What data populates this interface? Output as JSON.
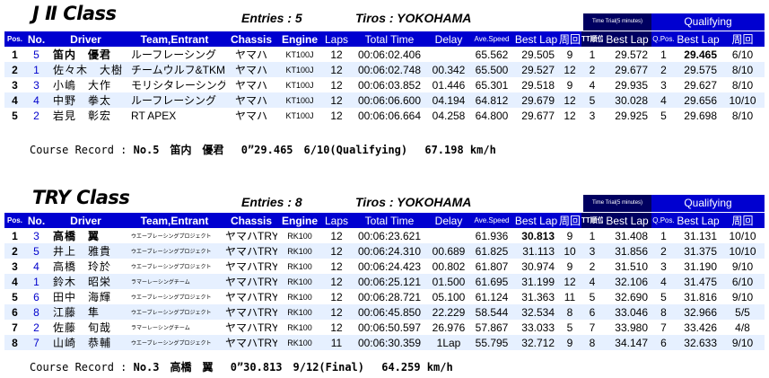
{
  "columns": [
    "Pos.",
    "No.",
    "Driver",
    "Team,Entrant",
    "Chassis",
    "Engine",
    "Laps",
    "Total Time",
    "Delay",
    "Ave.Speed",
    "Best Lap",
    "周回",
    "TT順位",
    "Best Lap",
    "Q.Pos.",
    "Best Lap",
    "周回"
  ],
  "tt_label": "Time Trial(5 minutes)",
  "q_label": "Qualifying",
  "sections": [
    {
      "title": "J Ⅱ Class",
      "entries": "Entries : 5",
      "tiros": "Tiros : YOKOHAMA",
      "rows": [
        {
          "pos": "1",
          "no": "5",
          "driver": "笛内　優君",
          "team": "ルーフレーシング",
          "chassis": "ヤマハ",
          "engine": "KT100J",
          "laps": "12",
          "total": "00:06:02.406",
          "delay": "",
          "ave": "65.562",
          "best": "29.505",
          "lap": "9",
          "ttpos": "1",
          "ttbest": "29.572",
          "qpos": "1",
          "qbest": "29.465",
          "qlap": "6/10"
        },
        {
          "pos": "2",
          "no": "1",
          "driver": "佐々木　大樹",
          "team": "チームウルフ&TKM",
          "chassis": "ヤマハ",
          "engine": "KT100J",
          "laps": "12",
          "total": "00:06:02.748",
          "delay": "00.342",
          "ave": "65.500",
          "best": "29.527",
          "lap": "12",
          "ttpos": "2",
          "ttbest": "29.677",
          "qpos": "2",
          "qbest": "29.575",
          "qlap": "8/10"
        },
        {
          "pos": "3",
          "no": "3",
          "driver": "小嶋　大作",
          "team": "モリシタレーシング",
          "chassis": "ヤマハ",
          "engine": "KT100J",
          "laps": "12",
          "total": "00:06:03.852",
          "delay": "01.446",
          "ave": "65.301",
          "best": "29.518",
          "lap": "9",
          "ttpos": "4",
          "ttbest": "29.935",
          "qpos": "3",
          "qbest": "29.627",
          "qlap": "8/10"
        },
        {
          "pos": "4",
          "no": "4",
          "driver": "中野　拳太",
          "team": "ルーフレーシング",
          "chassis": "ヤマハ",
          "engine": "KT100J",
          "laps": "12",
          "total": "00:06:06.600",
          "delay": "04.194",
          "ave": "64.812",
          "best": "29.679",
          "lap": "12",
          "ttpos": "5",
          "ttbest": "30.028",
          "qpos": "4",
          "qbest": "29.656",
          "qlap": "10/10"
        },
        {
          "pos": "5",
          "no": "2",
          "driver": "岩見　彰宏",
          "team": "RT APEX",
          "chassis": "ヤマハ",
          "engine": "KT100J",
          "laps": "12",
          "total": "00:06:06.664",
          "delay": "04.258",
          "ave": "64.800",
          "best": "29.677",
          "lap": "12",
          "ttpos": "3",
          "ttbest": "29.925",
          "qpos": "5",
          "qbest": "29.698",
          "qlap": "8/10"
        }
      ],
      "record_label": "Course Record :",
      "record_value": "No.5　笛内　優君　 0”29.465　6/10(Qualifying)　 67.198 km/h"
    },
    {
      "title": "TRY Class",
      "entries": "Entries : 8",
      "tiros": "Tiros : YOKOHAMA",
      "rows": [
        {
          "pos": "1",
          "no": "3",
          "driver": "高橋　翼",
          "team": "ウエーブレーシングプロジェクト",
          "chassis": "ヤマハTRY",
          "engine": "RK100",
          "laps": "12",
          "total": "00:06:23.621",
          "delay": "",
          "ave": "61.936",
          "best": "30.813",
          "lap": "9",
          "ttpos": "1",
          "ttbest": "31.408",
          "qpos": "1",
          "qbest": "31.131",
          "qlap": "10/10"
        },
        {
          "pos": "2",
          "no": "5",
          "driver": "井上　雅貴",
          "team": "ウエーブレーシングプロジェクト",
          "chassis": "ヤマハTRY",
          "engine": "RK100",
          "laps": "12",
          "total": "00:06:24.310",
          "delay": "00.689",
          "ave": "61.825",
          "best": "31.113",
          "lap": "10",
          "ttpos": "3",
          "ttbest": "31.856",
          "qpos": "2",
          "qbest": "31.375",
          "qlap": "10/10"
        },
        {
          "pos": "3",
          "no": "4",
          "driver": "高橋　玲於",
          "team": "ウエーブレーシングプロジェクト",
          "chassis": "ヤマハTRY",
          "engine": "RK100",
          "laps": "12",
          "total": "00:06:24.423",
          "delay": "00.802",
          "ave": "61.807",
          "best": "30.974",
          "lap": "9",
          "ttpos": "2",
          "ttbest": "31.510",
          "qpos": "3",
          "qbest": "31.190",
          "qlap": "9/10"
        },
        {
          "pos": "4",
          "no": "1",
          "driver": "鈴木　昭栄",
          "team": "ラマーレーシングチーム",
          "chassis": "ヤマハTRY",
          "engine": "RK100",
          "laps": "12",
          "total": "00:06:25.121",
          "delay": "01.500",
          "ave": "61.695",
          "best": "31.199",
          "lap": "12",
          "ttpos": "4",
          "ttbest": "32.106",
          "qpos": "4",
          "qbest": "31.475",
          "qlap": "6/10"
        },
        {
          "pos": "5",
          "no": "6",
          "driver": "田中　海輝",
          "team": "ウエーブレーシングプロジェクト",
          "chassis": "ヤマハTRY",
          "engine": "RK100",
          "laps": "12",
          "total": "00:06:28.721",
          "delay": "05.100",
          "ave": "61.124",
          "best": "31.363",
          "lap": "11",
          "ttpos": "5",
          "ttbest": "32.690",
          "qpos": "5",
          "qbest": "31.816",
          "qlap": "9/10"
        },
        {
          "pos": "6",
          "no": "8",
          "driver": "江藤　隼",
          "team": "ウエーブレーシングプロジェクト",
          "chassis": "ヤマハTRY",
          "engine": "RK100",
          "laps": "12",
          "total": "00:06:45.850",
          "delay": "22.229",
          "ave": "58.544",
          "best": "32.534",
          "lap": "8",
          "ttpos": "6",
          "ttbest": "33.046",
          "qpos": "8",
          "qbest": "32.966",
          "qlap": "5/5"
        },
        {
          "pos": "7",
          "no": "2",
          "driver": "佐藤　旬哉",
          "team": "ラマーレーシングチーム",
          "chassis": "ヤマハTRY",
          "engine": "RK100",
          "laps": "12",
          "total": "00:06:50.597",
          "delay": "26.976",
          "ave": "57.867",
          "best": "33.033",
          "lap": "5",
          "ttpos": "7",
          "ttbest": "33.980",
          "qpos": "7",
          "qbest": "33.426",
          "qlap": "4/8"
        },
        {
          "pos": "8",
          "no": "7",
          "driver": "山崎　恭輔",
          "team": "ウエーブレーシングプロジェクト",
          "chassis": "ヤマハTRY",
          "engine": "RK100",
          "laps": "11",
          "total": "00:06:30.359",
          "delay": "1Lap",
          "ave": "55.795",
          "best": "32.712",
          "lap": "9",
          "ttpos": "8",
          "ttbest": "34.147",
          "qpos": "6",
          "qbest": "32.633",
          "qlap": "9/10"
        }
      ],
      "record_label": "Course Record :",
      "record_value": "No.3　高橋　翼　 0”30.813　9/12(Final)　 64.259 km/h"
    }
  ]
}
